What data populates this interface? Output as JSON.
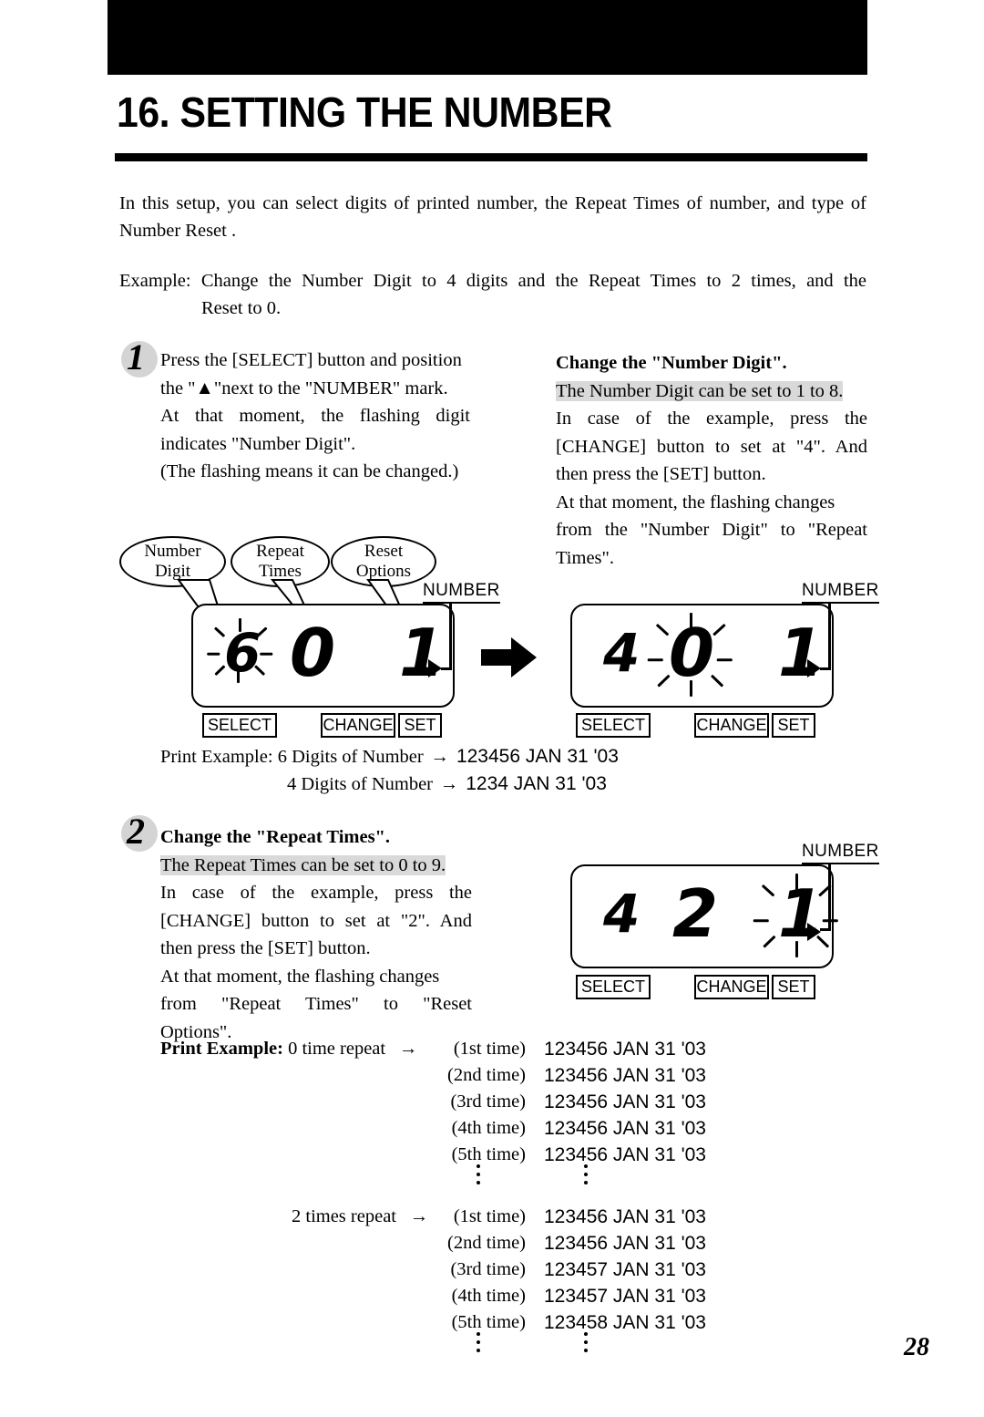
{
  "header": {
    "title": "16. SETTING THE NUMBER"
  },
  "intro": {
    "paragraph": "In this setup, you can select digits of printed number, the Repeat Times of number, and type of Number Reset .",
    "example_label": "Example:",
    "example_line1": "Change the Number Digit to 4 digits and the Repeat Times to 2 times, and the",
    "example_line2": "Reset to 0."
  },
  "step1": {
    "number": "1",
    "left": {
      "l1": "Press the [SELECT] button and position",
      "l2": "the \"▲\"next to the \"NUMBER\" mark.",
      "l3": "At that moment, the flashing digit",
      "l4": "indicates \"Number Digit\".",
      "l5": "(The flashing means it can be changed.)"
    },
    "right": {
      "heading": "Change the \"Number Digit\".",
      "highlight": "The Number Digit can be set to 1 to 8.",
      "l1": "In case of the example, press the",
      "l2": "[CHANGE] button to set at \"4\". And",
      "l3": "then press the [SET] button.",
      "l4": "At that moment, the flashing changes",
      "l5": "from the \"Number Digit\" to \"Repeat",
      "l6": "Times\"."
    },
    "print_example": {
      "label": "Print Example:",
      "row1_label": "6 Digits of Number",
      "row1_arrow": "→",
      "row1_value": "123456 JAN 31 '03",
      "row2_label": "4 Digits of Number",
      "row2_arrow": "→",
      "row2_value": "1234 JAN 31 '03"
    }
  },
  "step2": {
    "number": "2",
    "heading": "Change the \"Repeat Times\".",
    "highlight": "The Repeat Times can be set to 0 to 9.",
    "l1": "In case of the example, press the",
    "l2": "[CHANGE] button to set at \"2\". And",
    "l3": "then press the [SET] button.",
    "l4": "At that moment, the flashing changes",
    "l5": "from \"Repeat Times\" to \"Reset",
    "l6": "Options\".",
    "print_example": {
      "label": "Print Example:",
      "group1_label": "0 time repeat",
      "group1_arrow": "→",
      "group2_label": "2 times repeat",
      "group2_arrow": "→",
      "times": [
        "(1st time)",
        "(2nd time)",
        "(3rd time)",
        "(4th time)",
        "(5th time)"
      ],
      "group1_values": [
        "123456 JAN 31 '03",
        "123456 JAN 31 '03",
        "123456 JAN 31 '03",
        "123456 JAN 31 '03",
        "123456 JAN 31 '03"
      ],
      "group2_values": [
        "123456 JAN 31 '03",
        "123456 JAN 31 '03",
        "123457 JAN 31 '03",
        "123457 JAN 31 '03",
        "123458 JAN 31 '03"
      ]
    }
  },
  "callouts": {
    "number_digit_l1": "Number",
    "number_digit_l2": "Digit",
    "repeat_times_l1": "Repeat",
    "repeat_times_l2": "Times",
    "reset_options_l1": "Reset",
    "reset_options_l2": "Options"
  },
  "panels": [
    {
      "id": "panel-1",
      "number_mark": "NUMBER",
      "digits": [
        "6",
        "0",
        "1"
      ],
      "flashing_index": 0,
      "buttons": [
        "SELECT",
        "CHANGE",
        "SET"
      ]
    },
    {
      "id": "panel-2",
      "number_mark": "NUMBER",
      "digits": [
        "4",
        "0",
        "1"
      ],
      "flashing_index": 1,
      "buttons": [
        "SELECT",
        "CHANGE",
        "SET"
      ]
    },
    {
      "id": "panel-3",
      "number_mark": "NUMBER",
      "digits": [
        "4",
        "2",
        "1"
      ],
      "flashing_index": 2,
      "buttons": [
        "SELECT",
        "CHANGE",
        "SET"
      ]
    }
  ],
  "footer": {
    "page_number": "28"
  }
}
